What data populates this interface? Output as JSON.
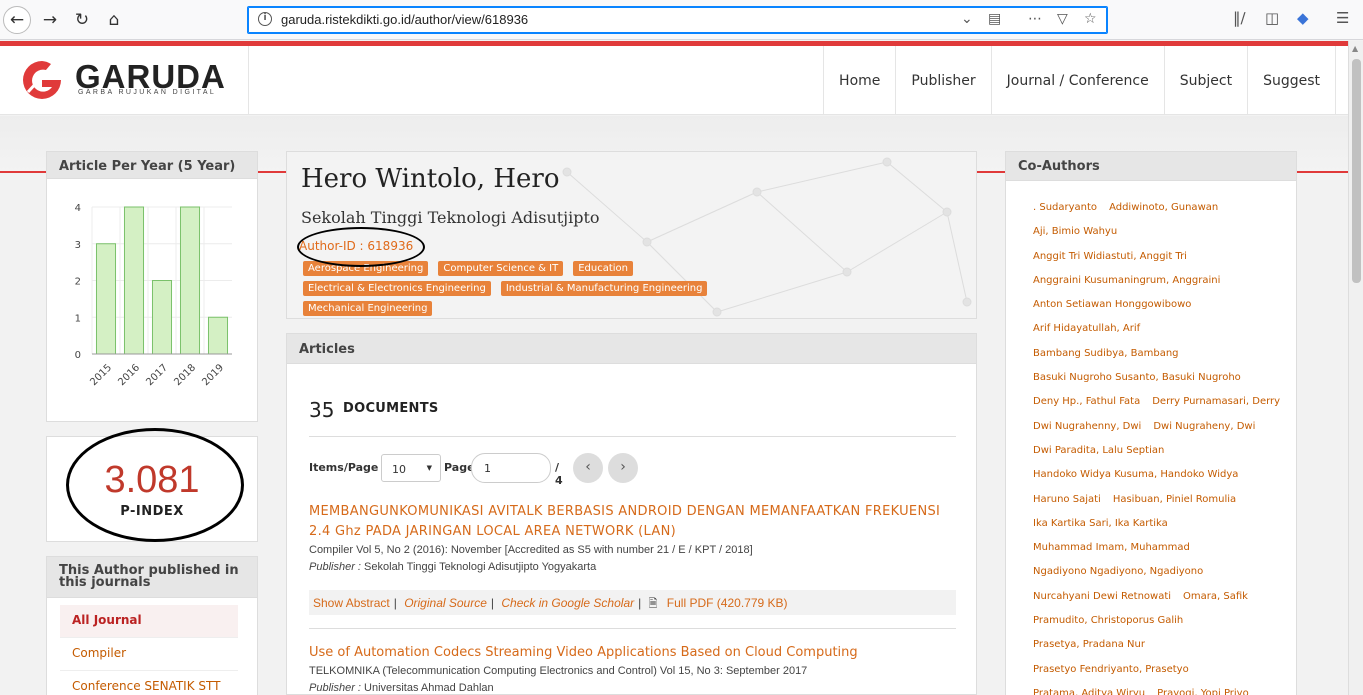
{
  "browser": {
    "url": "garuda.ristekdikti.go.id/author/view/618936",
    "icons": [
      "back-icon",
      "forward-icon",
      "reload-icon",
      "home-icon",
      "info-icon",
      "chevron-down-icon",
      "reader-icon",
      "more-icon",
      "pocket-icon",
      "star-icon",
      "library-icon",
      "sidebar-icon",
      "extension-icon",
      "menu-icon"
    ]
  },
  "site": {
    "logo_text": "GARUDA",
    "logo_sub": "GARBA RUJUKAN DIGITAL",
    "menu": [
      "Home",
      "Publisher",
      "Journal / Conference",
      "Subject",
      "Suggest"
    ]
  },
  "sidebar": {
    "chart_title": "Article Per Year (5 Year)",
    "pindex_value": "3.081",
    "pindex_label": "P-INDEX",
    "journals_title": "This Author published in this journals",
    "journals": [
      "All Journal",
      "Compiler",
      "Conference SENATIK STT"
    ]
  },
  "chart_data": {
    "type": "bar",
    "categories": [
      "2015",
      "2016",
      "2017",
      "2018",
      "2019"
    ],
    "values": [
      3,
      4,
      2,
      4,
      1
    ],
    "ylim": [
      0,
      4
    ],
    "yticks": [
      "0",
      "1",
      "2",
      "3",
      "4"
    ],
    "bar_color": "#d4f0c4",
    "bar_stroke": "#7ac16a",
    "grid": true
  },
  "profile": {
    "name": "Hero Wintolo, Hero",
    "affiliation": "Sekolah Tinggi Teknologi Adisutjipto",
    "author_id": "Author-ID : 618936",
    "tags": [
      "Aerospace Engineering",
      "Computer Science & IT",
      "Education",
      "Electrical & Electronics Engineering",
      "Industrial & Manufacturing Engineering",
      "Mechanical Engineering"
    ]
  },
  "articles": {
    "title": "Articles",
    "count": "35",
    "count_label": "DOCUMENTS",
    "items_label": "Items/Page",
    "items_value": "10",
    "page_label": "Page",
    "page_value": "1",
    "page_total": "/ 4",
    "list": [
      {
        "title": "MEMBANGUNKOMUNIKASI AVITALK BERBASIS ANDROID DENGAN MEMANFAATKAN FREKUENSI 2.4 Ghz PADA JARINGAN LOCAL AREA NETWORK (LAN)",
        "meta": "Compiler Vol 5, No 2 (2016): November [Accredited as S5 with number 21 / E / KPT / 2018]",
        "publisher_label": "Publisher :",
        "publisher": "Sekolah Tinggi Teknologi Adisutjipto Yogyakarta",
        "links": {
          "abstract": "Show Abstract",
          "source": "Original Source",
          "scholar": "Check in Google Scholar",
          "pdf": "Full PDF (420.779 KB)"
        }
      },
      {
        "title": "Use of Automation Codecs Streaming Video Applications Based on Cloud Computing",
        "meta": "TELKOMNIKA (Telecommunication Computing Electronics and Control) Vol 15, No 3: September 2017",
        "publisher_label": "Publisher :",
        "publisher": "Universitas Ahmad Dahlan"
      }
    ]
  },
  "coauthors": {
    "title": "Co-Authors",
    "rows": [
      [
        ". Sudaryanto",
        "Addiwinoto, Gunawan"
      ],
      [
        "Aji, Bimio Wahyu"
      ],
      [
        "Anggit Tri Widiastuti, Anggit Tri"
      ],
      [
        "Anggraini Kusumaningrum, Anggraini"
      ],
      [
        "Anton Setiawan Honggowibowo"
      ],
      [
        "Arif Hidayatullah, Arif"
      ],
      [
        "Bambang Sudibya, Bambang"
      ],
      [
        "Basuki Nugroho Susanto, Basuki Nugroho"
      ],
      [
        "Deny Hp., Fathul Fata",
        "Derry Purnamasari, Derry"
      ],
      [
        "Dwi Nugrahenny, Dwi",
        "Dwi Nugraheny, Dwi"
      ],
      [
        "Dwi Paradita, Lalu Septian"
      ],
      [
        "Handoko Widya Kusuma, Handoko Widya"
      ],
      [
        "Haruno Sajati",
        "Hasibuan, Piniel Romulia"
      ],
      [
        "Ika Kartika Sari, Ika Kartika"
      ],
      [
        "Muhammad Imam, Muhammad"
      ],
      [
        "Ngadiyono Ngadiyono, Ngadiyono"
      ],
      [
        "Nurcahyani Dewi Retnowati",
        "Omara, Safik"
      ],
      [
        "Pramudito, Christoporus Galih"
      ],
      [
        "Prasetya, Pradana Nur"
      ],
      [
        "Prasetyo Fendriyanto, Prasetyo"
      ],
      [
        "Pratama, Aditya Wiryu",
        "Prayogi, Yopi Priyo"
      ]
    ]
  }
}
